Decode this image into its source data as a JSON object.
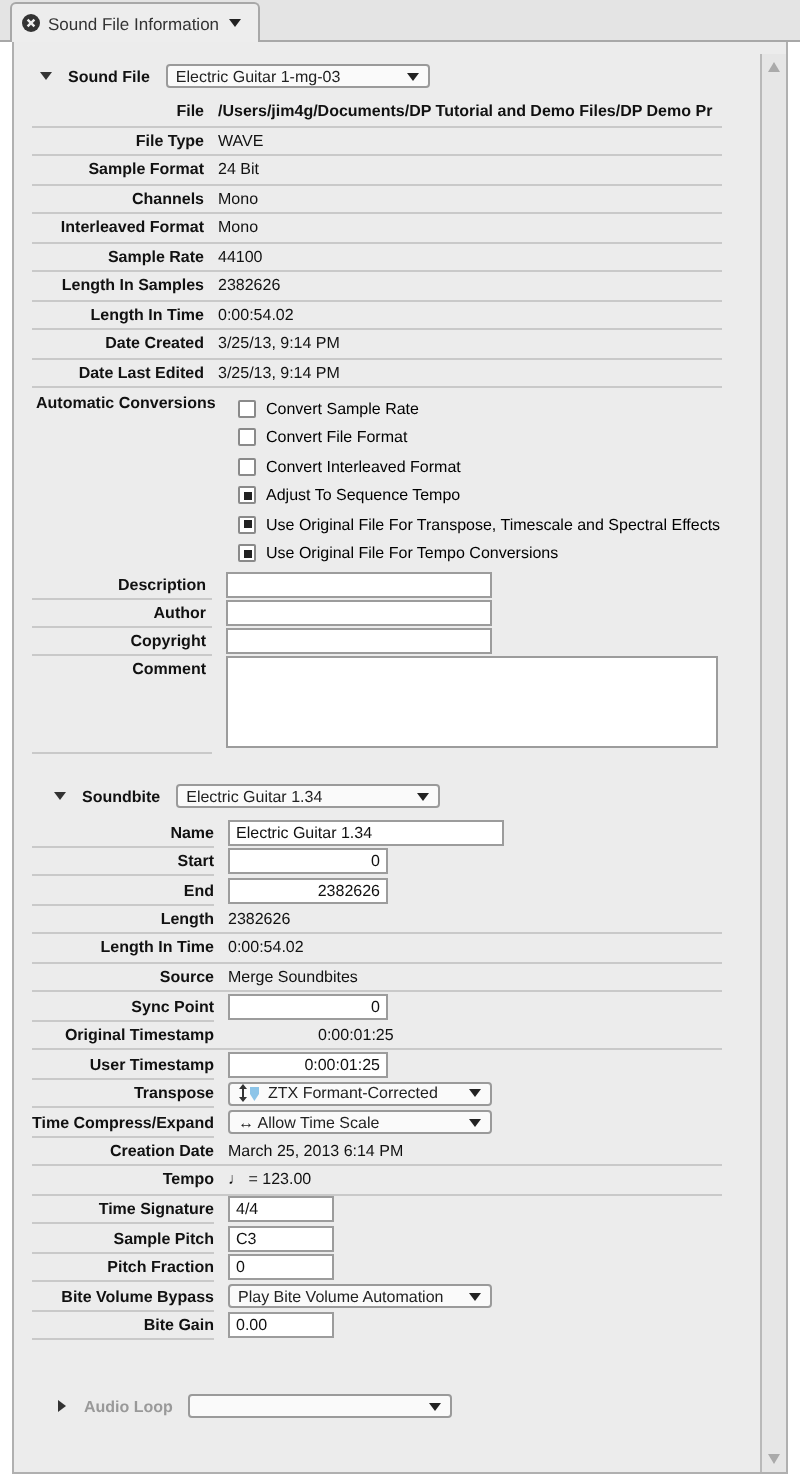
{
  "tab": {
    "label": "Sound File Information"
  },
  "sound_file": {
    "label": "Sound File",
    "expanded": true,
    "selector": "Electric Guitar 1-mg-03",
    "rows": [
      {
        "label": "File",
        "value": "/Users/jim4g/Documents/DP Tutorial and Demo Files/DP Demo Pr",
        "bold": true
      },
      {
        "label": "File Type",
        "value": "WAVE",
        "bold": false
      },
      {
        "label": "Sample Format",
        "value": "24 Bit",
        "bold": false
      },
      {
        "label": "Channels",
        "value": "Mono",
        "bold": false
      },
      {
        "label": "Interleaved Format",
        "value": "Mono",
        "bold": false
      },
      {
        "label": "Sample Rate",
        "value": "44100",
        "bold": false
      },
      {
        "label": "Length In Samples",
        "value": "2382626",
        "bold": false
      },
      {
        "label": "Length In Time",
        "value": "0:00:54.02",
        "bold": false
      },
      {
        "label": "Date Created",
        "value": "3/25/13, 9:14 PM",
        "bold": false
      },
      {
        "label": "Date Last Edited",
        "value": "3/25/13, 9:14 PM",
        "bold": false
      }
    ],
    "conversions": {
      "label": "Automatic Conversions",
      "options": [
        {
          "label": "Convert Sample Rate",
          "checked": false
        },
        {
          "label": "Convert File Format",
          "checked": false
        },
        {
          "label": "Convert Interleaved Format",
          "checked": false
        },
        {
          "label": "Adjust To Sequence Tempo",
          "checked": true
        },
        {
          "label": "Use Original File For Transpose, Timescale and Spectral Effects",
          "checked": true
        },
        {
          "label": "Use Original File For Tempo Conversions",
          "checked": true
        }
      ]
    },
    "fields": [
      {
        "label": "Description",
        "kind": "line"
      },
      {
        "label": "Author",
        "kind": "line"
      },
      {
        "label": "Copyright",
        "kind": "line"
      },
      {
        "label": "Comment",
        "kind": "area"
      }
    ]
  },
  "soundbite": {
    "label": "Soundbite",
    "expanded": true,
    "selector": "Electric Guitar 1.34",
    "rows": [
      {
        "label": "Name",
        "kind": "wide-field",
        "value": "Electric Guitar 1.34"
      },
      {
        "label": "Start",
        "kind": "number",
        "value": "0"
      },
      {
        "label": "End",
        "kind": "number",
        "value": "2382626"
      },
      {
        "label": "Length",
        "kind": "text",
        "value": "2382626"
      },
      {
        "label": "Length In Time",
        "kind": "text",
        "value": "0:00:54.02"
      },
      {
        "label": "Source",
        "kind": "text",
        "value": "Merge Soundbites"
      },
      {
        "label": "Sync Point",
        "kind": "number",
        "value": "0"
      },
      {
        "label": "Original Timestamp",
        "kind": "time",
        "value": "0:00:01:25"
      },
      {
        "label": "User Timestamp",
        "kind": "number",
        "value": "0:00:01:25"
      },
      {
        "label": "Transpose",
        "kind": "pitch-select",
        "value": "ZTX Formant-Corrected"
      },
      {
        "label": "Time Compress/Expand",
        "kind": "select",
        "value": "↔ Allow Time Scale"
      },
      {
        "label": "Creation Date",
        "kind": "text",
        "value": "March 25, 2013 6:14 PM"
      },
      {
        "label": "Tempo",
        "kind": "text",
        "value": "♩ = 123.00"
      },
      {
        "label": "Time Signature",
        "kind": "field",
        "value": "4/4"
      },
      {
        "label": "Sample Pitch",
        "kind": "field",
        "value": "C3"
      },
      {
        "label": "Pitch Fraction",
        "kind": "field",
        "value": "0"
      },
      {
        "label": "Bite Volume Bypass",
        "kind": "select",
        "value": "Play Bite Volume Automation"
      },
      {
        "label": "Bite Gain",
        "kind": "field",
        "value": "0.00"
      }
    ]
  },
  "audio_loop": {
    "label": "Audio Loop",
    "expanded": false,
    "disabled": true
  }
}
